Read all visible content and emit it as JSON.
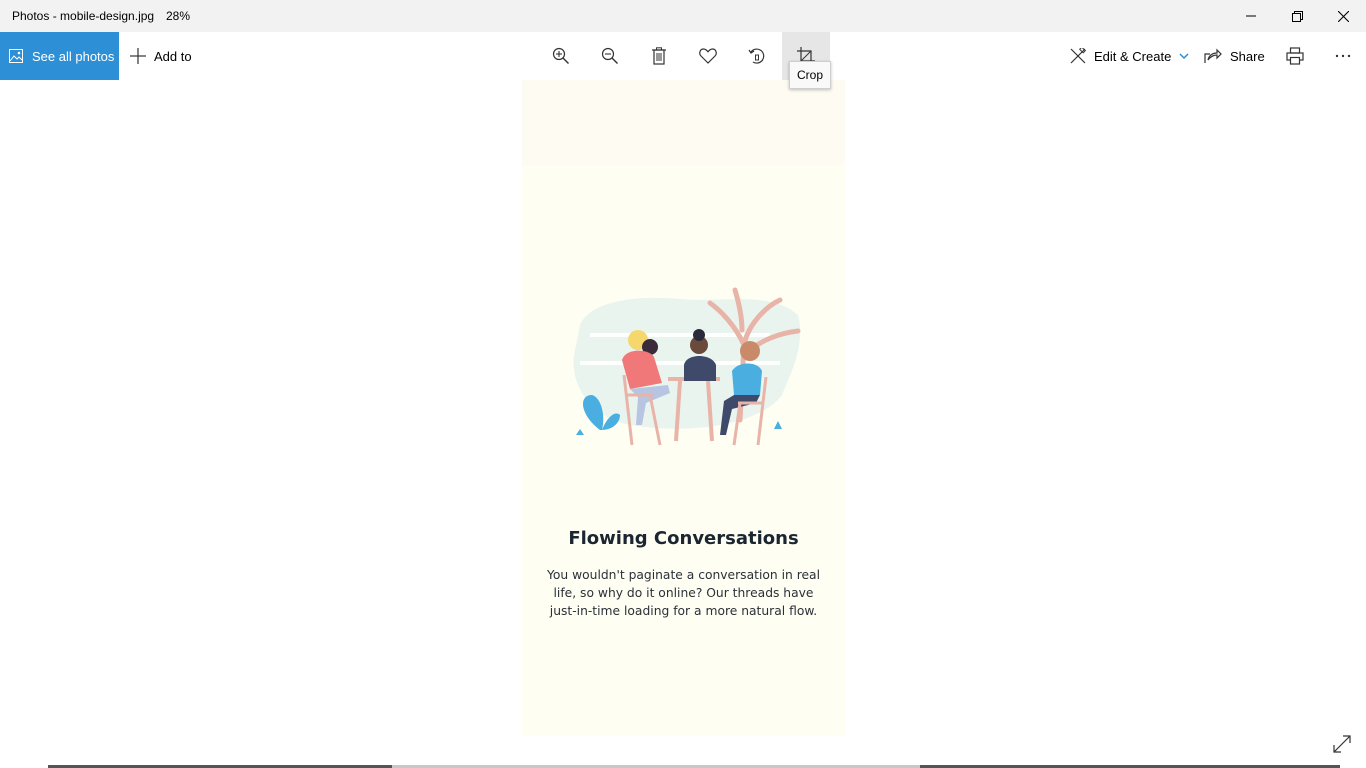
{
  "titlebar": {
    "title": "Photos - mobile-design.jpg",
    "zoom": "28%",
    "minimize": "minimize-icon",
    "restore": "restore-icon",
    "close": "close-icon"
  },
  "toolbar": {
    "see_all_label": "See all photos",
    "add_to_label": "Add to",
    "tools": [
      {
        "name": "zoom-in",
        "icon": "zoom-in-icon"
      },
      {
        "name": "zoom-out",
        "icon": "zoom-out-icon"
      },
      {
        "name": "delete",
        "icon": "trash-icon"
      },
      {
        "name": "favorite",
        "icon": "heart-icon"
      },
      {
        "name": "rotate",
        "icon": "rotate-icon"
      },
      {
        "name": "crop",
        "icon": "crop-icon"
      }
    ],
    "tooltip": "Crop",
    "edit_create_label": "Edit & Create",
    "share_label": "Share",
    "print_icon": "print-icon",
    "more_icon": "more-icon",
    "accent": "#2d8fd6"
  },
  "image": {
    "headline": "Flowing Conversations",
    "body": "You wouldn't paginate a conversation in real life, so why do it online? Our threads have just-in-time loading for a more natural flow.",
    "background": "#fffef2"
  },
  "footer": {
    "fullscreen_icon": "expand-icon"
  }
}
